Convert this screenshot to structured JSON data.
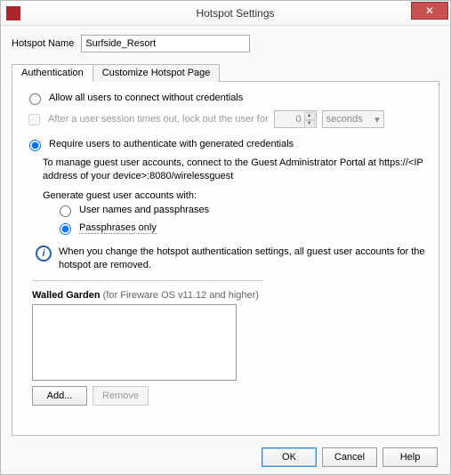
{
  "window": {
    "title": "Hotspot Settings",
    "close_glyph": "✕"
  },
  "hotspot_name": {
    "label": "Hotspot Name",
    "value": "Surfside_Resort"
  },
  "tabs": {
    "auth": "Authentication",
    "customize": "Customize Hotspot Page"
  },
  "auth": {
    "allow_all_label": "Allow all users to connect without credentials",
    "lockout_prefix": "After a user session times out, lock out the user for",
    "lockout_value": "0",
    "lockout_unit": "seconds",
    "require_label": "Require users to authenticate with generated credentials",
    "mgmt_note": "To manage guest user accounts, connect to the Guest Administrator Portal at https://<IP address of your device>:8080/wirelessguest",
    "generate_label": "Generate guest user accounts with:",
    "opt_user_pass": "User names and passphrases",
    "opt_pass_only": "Passphrases only",
    "info_note": "When you change the hotspot authentication settings, all guest user accounts for the hotspot are removed."
  },
  "walled_garden": {
    "label": "Walled Garden",
    "sublabel": "(for Fireware OS v11.12 and higher)",
    "add_label": "Add...",
    "remove_label": "Remove"
  },
  "dialog_buttons": {
    "ok": "OK",
    "cancel": "Cancel",
    "help": "Help"
  }
}
